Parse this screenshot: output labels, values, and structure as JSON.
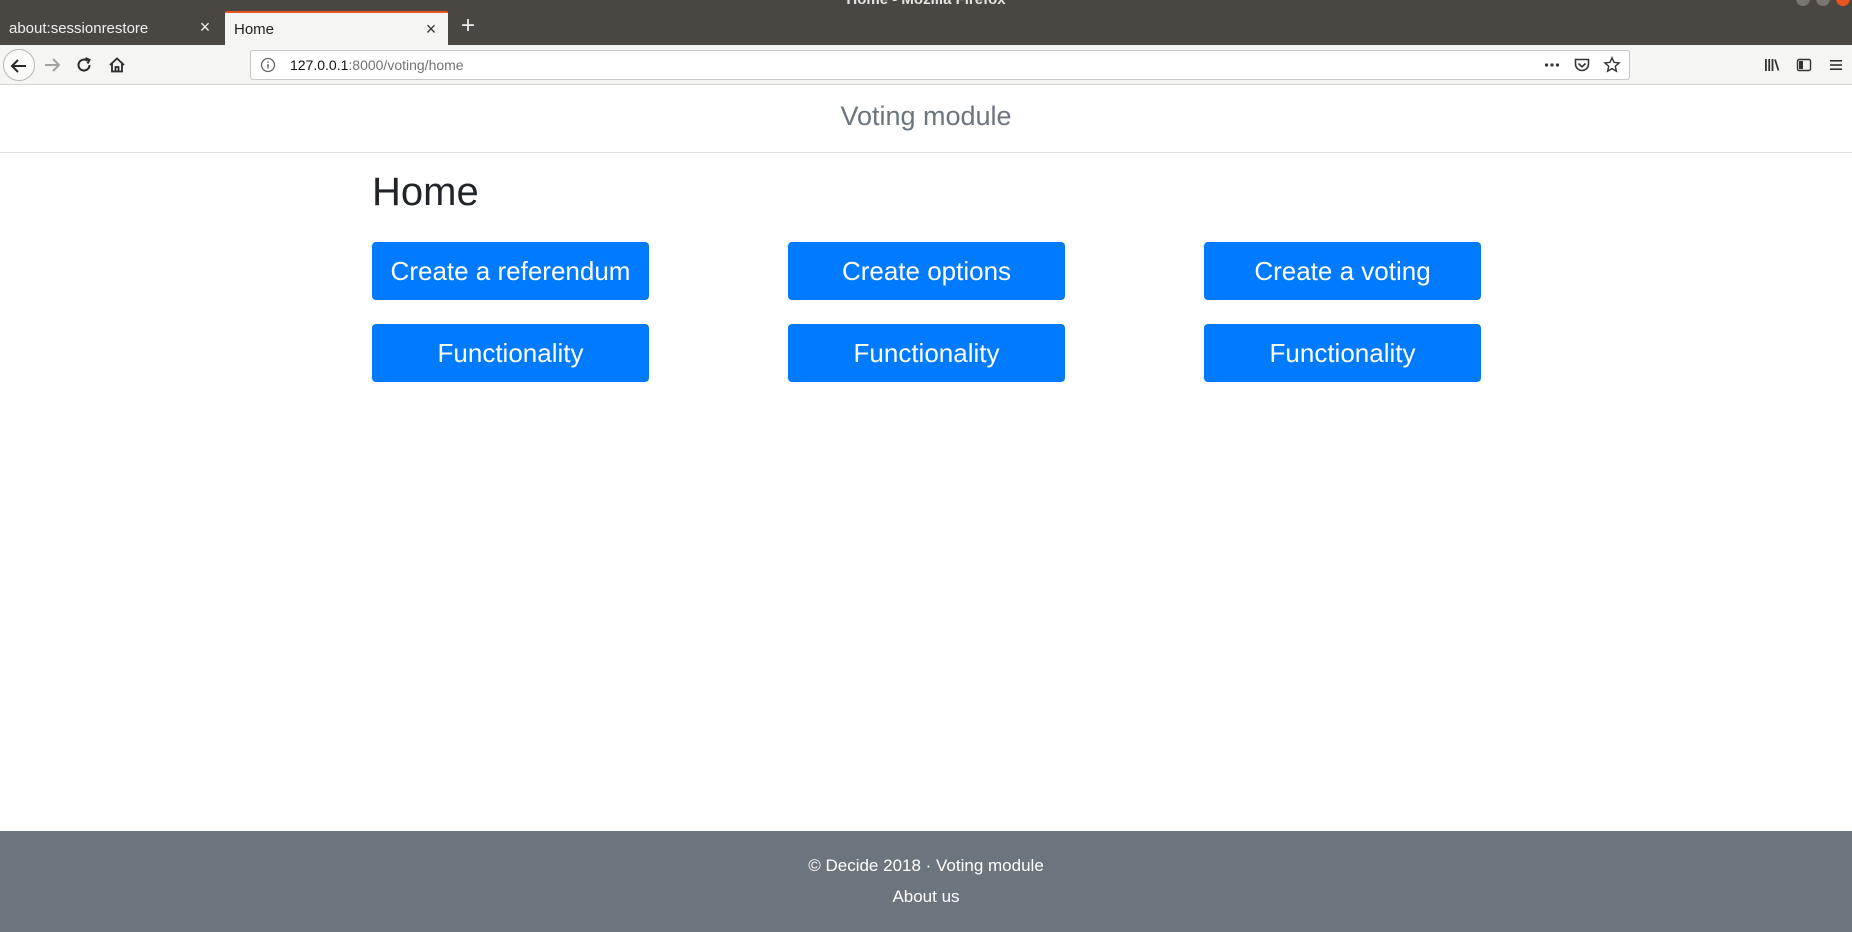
{
  "browser": {
    "window_title": "Home - Mozilla Firefox",
    "tabs": [
      {
        "label": "about:sessionrestore",
        "active": false
      },
      {
        "label": "Home",
        "active": true
      }
    ],
    "url": {
      "host": "127.0.0.1",
      "path": ":8000/voting/home"
    },
    "icons": {
      "back": "back-arrow-icon",
      "forward": "forward-arrow-icon",
      "reload": "reload-icon",
      "home": "home-icon",
      "info": "info-icon",
      "page_actions": "ellipsis-icon",
      "pocket": "pocket-icon",
      "bookmark": "star-icon",
      "library": "library-icon",
      "sidebar": "sidebar-icon",
      "menu": "hamburger-menu-icon"
    },
    "accent_color": "#e95420"
  },
  "site": {
    "brand": "Voting module"
  },
  "main": {
    "heading": "Home",
    "buttons": [
      "Create a referendum",
      "Create options",
      "Create a voting",
      "Functionality",
      "Functionality",
      "Functionality"
    ],
    "button_color": "#007bff"
  },
  "footer": {
    "copyright": "© Decide 2018 · Voting module",
    "about_link": "About us",
    "background": "#6c757d"
  }
}
